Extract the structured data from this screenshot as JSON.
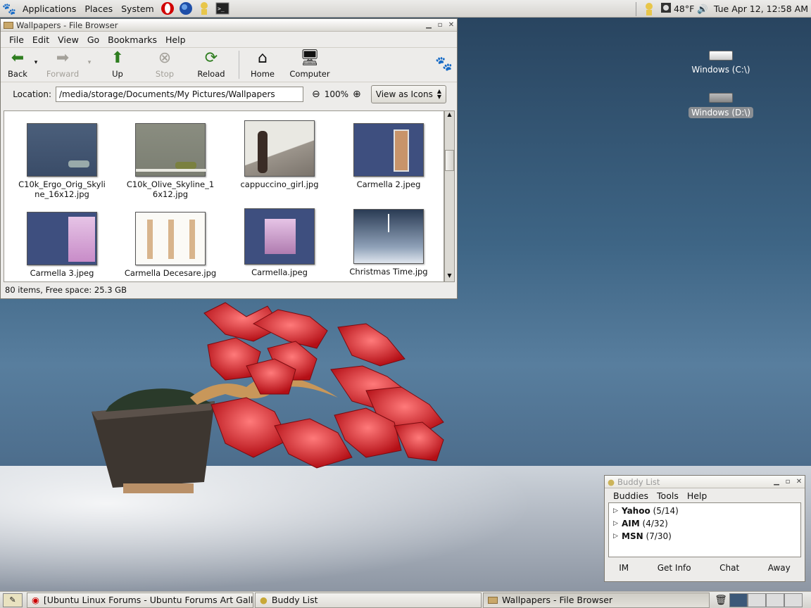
{
  "topbar": {
    "menus": [
      "Applications",
      "Places",
      "System"
    ],
    "weather": "48°F",
    "clock": "Tue Apr 12, 12:58 AM"
  },
  "desktop": {
    "icons": [
      {
        "label": "Windows (C:\\)"
      },
      {
        "label": "Windows (D:\\)"
      }
    ]
  },
  "file_browser": {
    "title": "Wallpapers - File Browser",
    "menus": [
      "File",
      "Edit",
      "View",
      "Go",
      "Bookmarks",
      "Help"
    ],
    "toolbar": {
      "back": "Back",
      "forward": "Forward",
      "up": "Up",
      "stop": "Stop",
      "reload": "Reload",
      "home": "Home",
      "computer": "Computer"
    },
    "location_label": "Location:",
    "location_value": "/media/storage/Documents/My Pictures/Wallpapers",
    "zoom": "100%",
    "view_as": "View as Icons",
    "files": [
      {
        "name": "C10k_Ergo_Orig_Skyline_16x12.jpg",
        "l1": "C10k_Ergo_Orig_Skyli",
        "l2": "ne_16x12.jpg"
      },
      {
        "name": "C10k_Olive_Skyline_16x12.jpg",
        "l1": "C10k_Olive_Skyline_1",
        "l2": "6x12.jpg"
      },
      {
        "name": "cappuccino_girl.jpg",
        "l1": "cappuccino_girl.jpg",
        "l2": ""
      },
      {
        "name": "Carmella 2.jpeg",
        "l1": "Carmella 2.jpeg",
        "l2": ""
      },
      {
        "name": "Carmella 3.jpeg",
        "l1": "Carmella 3.jpeg",
        "l2": ""
      },
      {
        "name": "Carmella Decesare.jpg",
        "l1": "Carmella Decesare.jpg",
        "l2": ""
      },
      {
        "name": "Carmella.jpeg",
        "l1": "Carmella.jpeg",
        "l2": ""
      },
      {
        "name": "Christmas Time.jpg",
        "l1": "Christmas Time.jpg",
        "l2": ""
      }
    ],
    "status": "80 items, Free space: 25.3 GB"
  },
  "buddy_list": {
    "title": "Buddy List",
    "menus": [
      "Buddies",
      "Tools",
      "Help"
    ],
    "groups": [
      {
        "name": "Yahoo",
        "count": "(5/14)"
      },
      {
        "name": "AIM",
        "count": "(4/32)"
      },
      {
        "name": "MSN",
        "count": "(7/30)"
      }
    ],
    "actions": [
      "IM",
      "Get Info",
      "Chat",
      "Away"
    ]
  },
  "taskbar": {
    "tasks": [
      {
        "label": "[Ubuntu Linux Forums - Ubuntu Forums Art Galle..."
      },
      {
        "label": "Buddy List"
      },
      {
        "label": "Wallpapers - File Browser"
      }
    ]
  },
  "colors": {
    "desktop": "#3e6585",
    "leaf_red": "#d81e24",
    "window_bg": "#edecea"
  }
}
